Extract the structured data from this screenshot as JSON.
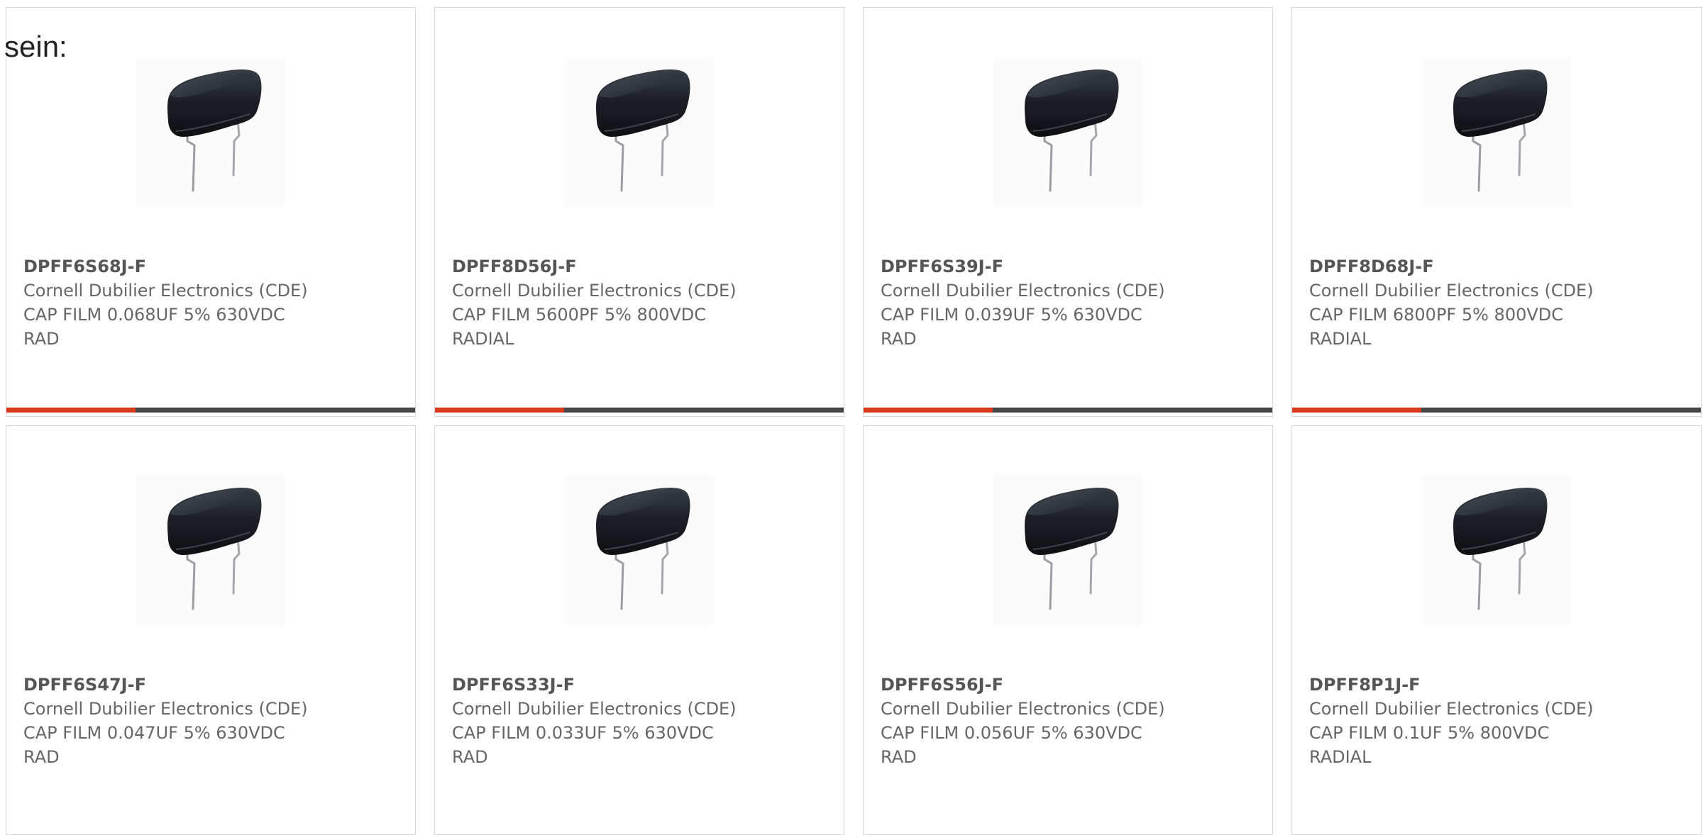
{
  "intro_text": "sein:",
  "colors": {
    "bar_accent": "#d9391a",
    "bar_base": "#454545",
    "card_border": "#d6d6d6"
  },
  "products": [
    {
      "part_number": "DPFF6S68J-F",
      "manufacturer": "Cornell Dubilier Electronics (CDE)",
      "description_line1": "CAP FILM 0.068UF 5% 630VDC",
      "description_line2": "RAD",
      "image_icon": "film-capacitor-image"
    },
    {
      "part_number": "DPFF8D56J-F",
      "manufacturer": "Cornell Dubilier Electronics (CDE)",
      "description_line1": "CAP FILM 5600PF 5% 800VDC",
      "description_line2": "RADIAL",
      "image_icon": "film-capacitor-image"
    },
    {
      "part_number": "DPFF6S39J-F",
      "manufacturer": "Cornell Dubilier Electronics (CDE)",
      "description_line1": "CAP FILM 0.039UF 5% 630VDC",
      "description_line2": "RAD",
      "image_icon": "film-capacitor-image"
    },
    {
      "part_number": "DPFF8D68J-F",
      "manufacturer": "Cornell Dubilier Electronics (CDE)",
      "description_line1": "CAP FILM 6800PF 5% 800VDC",
      "description_line2": "RADIAL",
      "image_icon": "film-capacitor-image"
    },
    {
      "part_number": "DPFF6S47J-F",
      "manufacturer": "Cornell Dubilier Electronics (CDE)",
      "description_line1": "CAP FILM 0.047UF 5% 630VDC",
      "description_line2": "RAD",
      "image_icon": "film-capacitor-image"
    },
    {
      "part_number": "DPFF6S33J-F",
      "manufacturer": "Cornell Dubilier Electronics (CDE)",
      "description_line1": "CAP FILM 0.033UF 5% 630VDC",
      "description_line2": "RAD",
      "image_icon": "film-capacitor-image"
    },
    {
      "part_number": "DPFF6S56J-F",
      "manufacturer": "Cornell Dubilier Electronics (CDE)",
      "description_line1": "CAP FILM 0.056UF 5% 630VDC",
      "description_line2": "RAD",
      "image_icon": "film-capacitor-image"
    },
    {
      "part_number": "DPFF8P1J-F",
      "manufacturer": "Cornell Dubilier Electronics (CDE)",
      "description_line1": "CAP FILM 0.1UF 5% 800VDC",
      "description_line2": "RADIAL",
      "image_icon": "film-capacitor-image"
    }
  ]
}
